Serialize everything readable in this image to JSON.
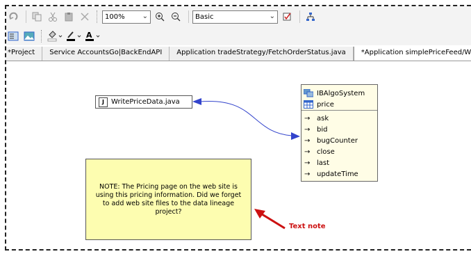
{
  "toolbar": {
    "zoom_value": "100%",
    "layout_value": "Basic"
  },
  "tabs": [
    {
      "label": "*Project"
    },
    {
      "label": "Service AccountsGo|BackEndAPI"
    },
    {
      "label": "Application tradeStrategy/FetchOrderStatus.java"
    },
    {
      "label": "*Application simplePriceFeed/WritePriceData.java"
    }
  ],
  "diagram": {
    "java_node": {
      "label": "WritePriceData.java",
      "icon": "java-file-icon"
    },
    "class_node": {
      "name": "IBAlgoSystem",
      "field": "price",
      "members": [
        "ask",
        "bid",
        "bugCounter",
        "close",
        "last",
        "updateTime"
      ]
    },
    "note": {
      "text": "NOTE: The Pricing page on the web site is using this pricing information. Did we forget to add web site files to the data lineage project?"
    },
    "annotation": {
      "text": "Text note",
      "color": "#cc1111"
    },
    "connector_color": "#3344cc"
  }
}
